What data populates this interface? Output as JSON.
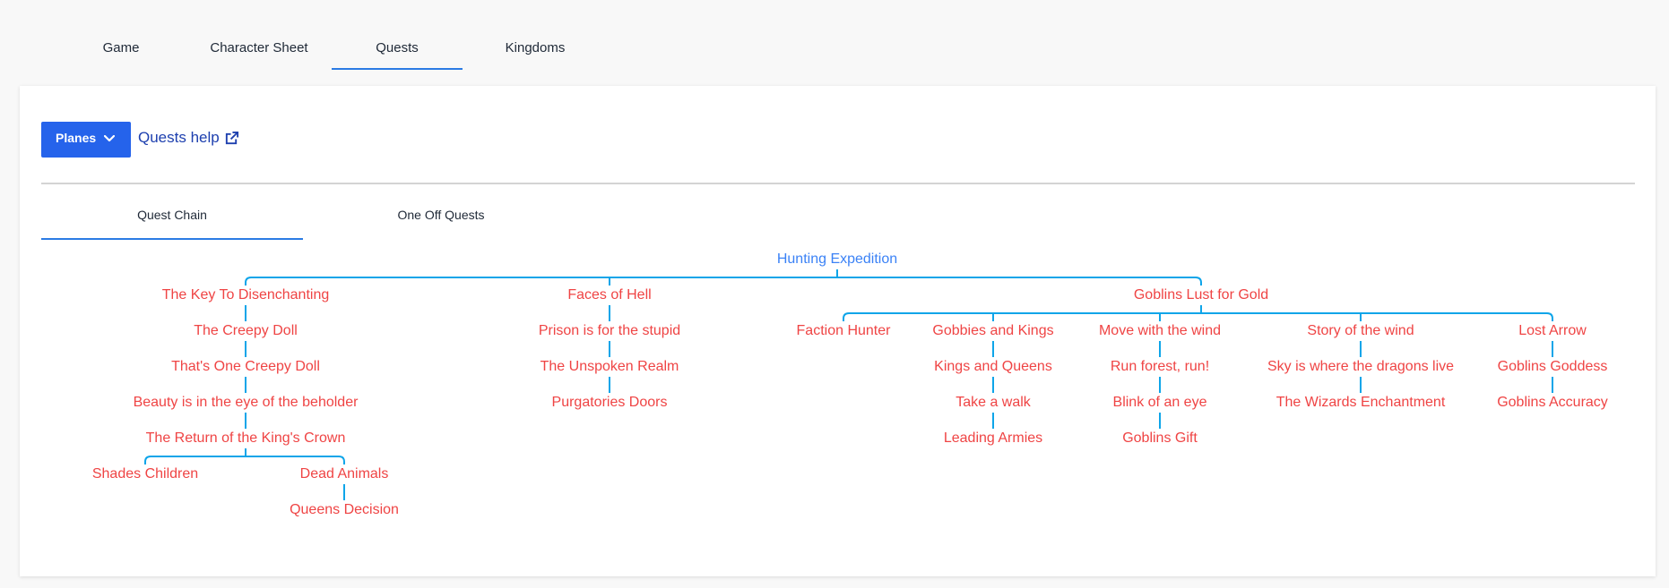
{
  "top_tabs": [
    {
      "label": "Game",
      "active": false
    },
    {
      "label": "Character Sheet",
      "active": false
    },
    {
      "label": "Quests",
      "active": true
    },
    {
      "label": "Kingdoms",
      "active": false
    }
  ],
  "toolbar": {
    "planes_label": "Planes",
    "help_label": "Quests help"
  },
  "sub_tabs": [
    {
      "label": "Quest Chain",
      "active": true
    },
    {
      "label": "One Off Quests",
      "active": false
    }
  ],
  "colors": {
    "accent": "#2b7be4",
    "primary_button": "#2563eb",
    "root_node": "#3b82f6",
    "quest_node": "#ef4444",
    "connector": "#0ea5e9"
  },
  "quest_tree": {
    "name": "Hunting Expedition",
    "children": [
      {
        "name": "The Key To Disenchanting",
        "children": [
          {
            "name": "The Creepy Doll",
            "children": [
              {
                "name": "That's One Creepy Doll",
                "children": [
                  {
                    "name": "Beauty is in the eye of the beholder",
                    "children": [
                      {
                        "name": "The Return of the King's Crown",
                        "children": [
                          {
                            "name": "Shades Children",
                            "children": []
                          },
                          {
                            "name": "Dead Animals",
                            "children": [
                              {
                                "name": "Queens Decision",
                                "children": []
                              }
                            ]
                          }
                        ]
                      }
                    ]
                  }
                ]
              }
            ]
          }
        ]
      },
      {
        "name": "Faces of Hell",
        "children": [
          {
            "name": "Prison is for the stupid",
            "children": [
              {
                "name": "The Unspoken Realm",
                "children": [
                  {
                    "name": "Purgatories Doors",
                    "children": []
                  }
                ]
              }
            ]
          }
        ]
      },
      {
        "name": "Goblins Lust for Gold",
        "children": [
          {
            "name": "Faction Hunter",
            "children": []
          },
          {
            "name": "Gobbies and Kings",
            "children": [
              {
                "name": "Kings and Queens",
                "children": [
                  {
                    "name": "Take a walk",
                    "children": [
                      {
                        "name": "Leading Armies",
                        "children": []
                      }
                    ]
                  }
                ]
              }
            ]
          },
          {
            "name": "Move with the wind",
            "children": [
              {
                "name": "Run forest, run!",
                "children": [
                  {
                    "name": "Blink of an eye",
                    "children": [
                      {
                        "name": "Goblins Gift",
                        "children": []
                      }
                    ]
                  }
                ]
              }
            ]
          },
          {
            "name": "Story of the wind",
            "children": [
              {
                "name": "Sky is where the dragons live",
                "children": [
                  {
                    "name": "The Wizards Enchantment",
                    "children": []
                  }
                ]
              }
            ]
          },
          {
            "name": "Lost Arrow",
            "children": [
              {
                "name": "Goblins Goddess",
                "children": [
                  {
                    "name": "Goblins Accuracy",
                    "children": []
                  }
                ]
              }
            ]
          }
        ]
      }
    ]
  }
}
